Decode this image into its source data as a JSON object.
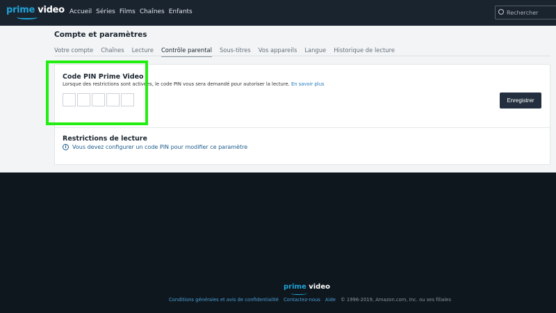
{
  "header": {
    "logo": {
      "prime": "prime",
      "video": "video"
    },
    "nav": [
      "Accueil",
      "Séries",
      "Films",
      "Chaînes",
      "Enfants"
    ],
    "search_placeholder": "Rechercher"
  },
  "page": {
    "title": "Compte et paramètres",
    "tabs": [
      "Votre compte",
      "Chaînes",
      "Lecture",
      "Contrôle parental",
      "Sous-titres",
      "Vos appareils",
      "Langue",
      "Historique de lecture"
    ],
    "active_tab": "Contrôle parental"
  },
  "pin": {
    "title": "Code PIN Prime Video",
    "desc": "Lorsque des restrictions sont activées, le code PIN vous sera demandé pour autoriser la lecture.",
    "link": "En savoir plus",
    "save": "Enregistrer"
  },
  "restrictions": {
    "title": "Restrictions de lecture",
    "info_icon": "i",
    "info": "Vous devez configurer un code PIN pour modifier ce paramètre"
  },
  "footer": {
    "logo": {
      "prime": "prime",
      "video": "video"
    },
    "links": [
      "Conditions générales et avis de confidentialité",
      "Contactez-nous",
      "Aide"
    ],
    "copyright": "© 1996-2019, Amazon.com, Inc. ou ses filiales"
  },
  "colors": {
    "highlight": "#22ee11",
    "accent": "#1fa3d6",
    "header": "#1a242f"
  }
}
